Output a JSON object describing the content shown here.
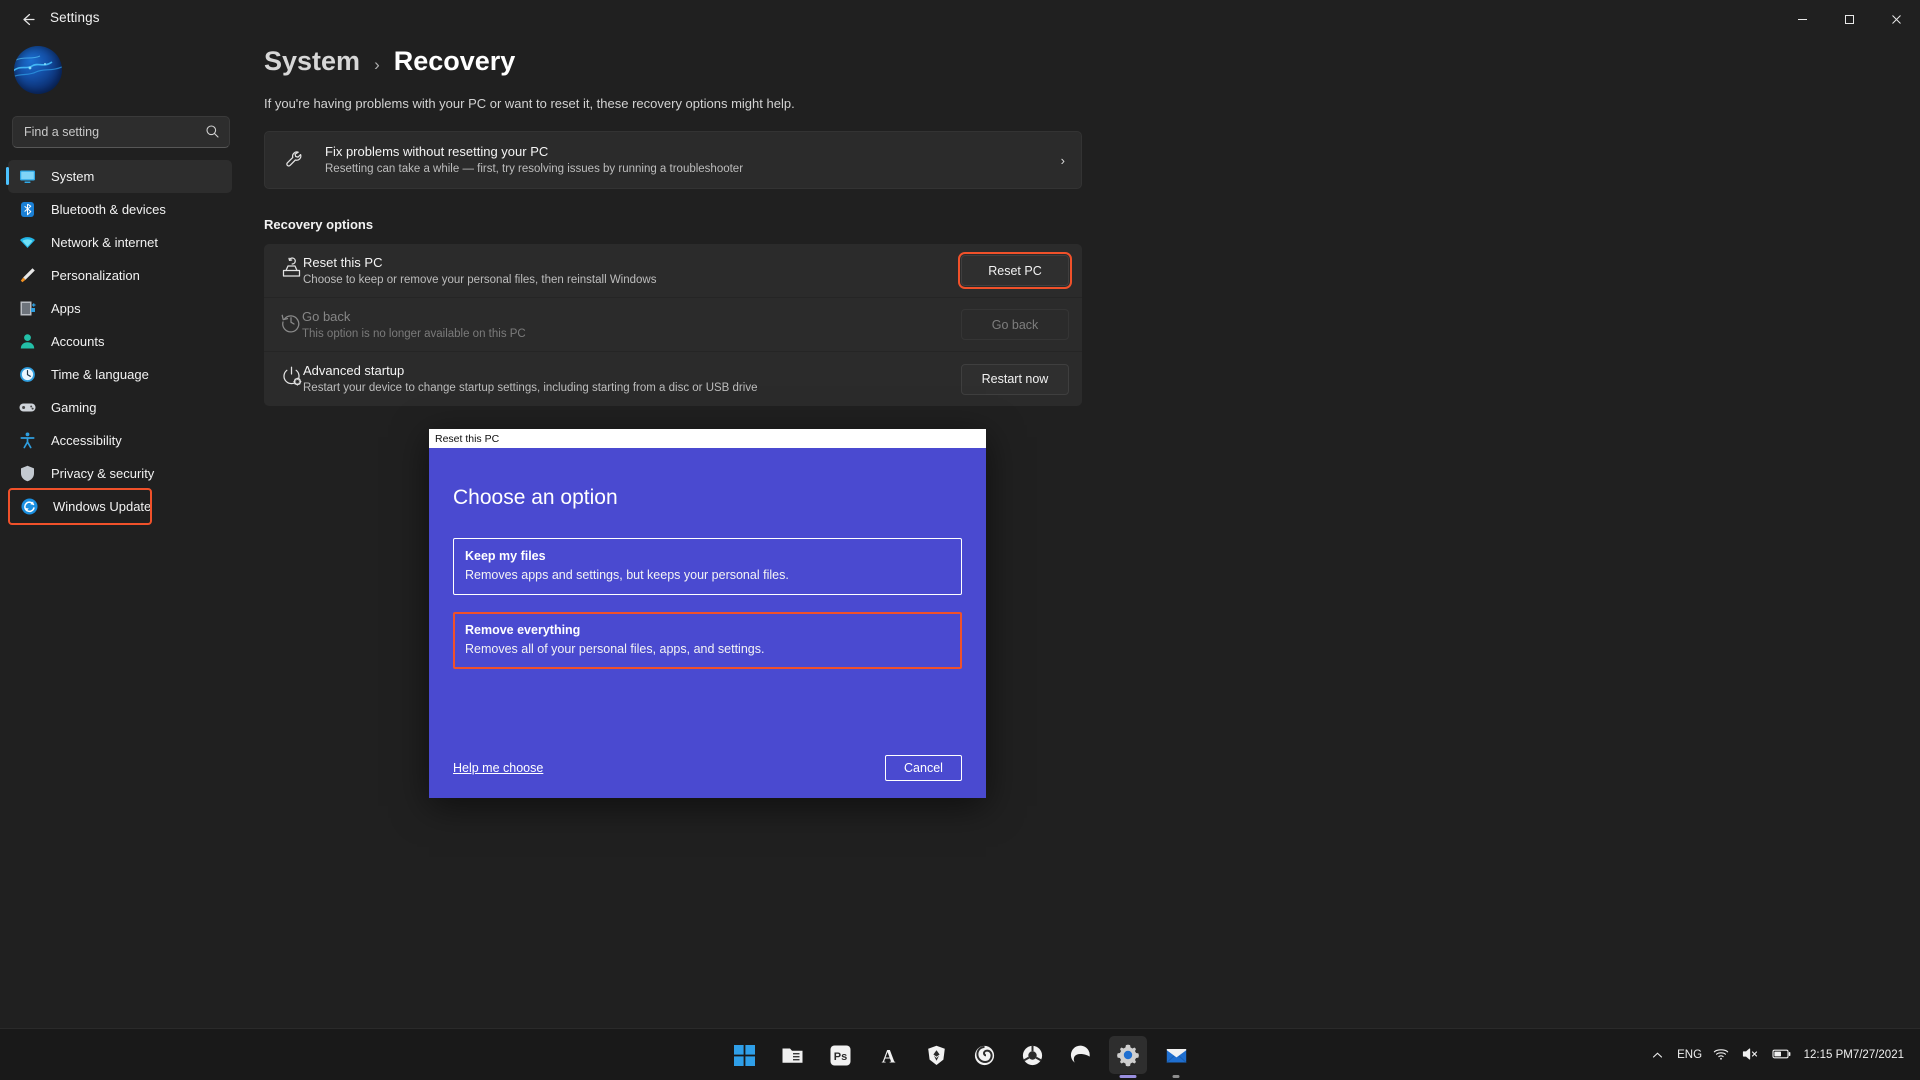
{
  "window": {
    "title": "Settings",
    "back_icon": "back-arrow-icon",
    "minimize": "–",
    "maximize": "❐",
    "close": "✕"
  },
  "sidebar": {
    "avatar_name": "user-avatar",
    "search": {
      "placeholder": "Find a setting",
      "icon": "search-icon"
    },
    "items": [
      {
        "label": "System",
        "icon": "system-monitor-icon",
        "state": "active"
      },
      {
        "label": "Bluetooth & devices",
        "icon": "bluetooth-icon",
        "state": "normal"
      },
      {
        "label": "Network & internet",
        "icon": "wifi-icon",
        "state": "normal"
      },
      {
        "label": "Personalization",
        "icon": "paintbrush-icon",
        "state": "normal"
      },
      {
        "label": "Apps",
        "icon": "apps-icon",
        "state": "normal"
      },
      {
        "label": "Accounts",
        "icon": "account-person-icon",
        "state": "normal"
      },
      {
        "label": "Time & language",
        "icon": "clock-icon",
        "state": "normal"
      },
      {
        "label": "Gaming",
        "icon": "gamepad-icon",
        "state": "normal"
      },
      {
        "label": "Accessibility",
        "icon": "accessibility-icon",
        "state": "normal"
      },
      {
        "label": "Privacy & security",
        "icon": "shield-icon",
        "state": "normal"
      },
      {
        "label": "Windows Update",
        "icon": "windows-update-icon",
        "state": "highlighted"
      }
    ]
  },
  "main": {
    "breadcrumb": {
      "parent": "System",
      "separator": "›",
      "current": "Recovery"
    },
    "subtitle": "If you're having problems with your PC or want to reset it, these recovery options might help.",
    "troubleshoot_card": {
      "icon": "wrench-icon",
      "title": "Fix problems without resetting your PC",
      "subtitle": "Resetting can take a while — first, try resolving issues by running a troubleshooter",
      "chevron": "›"
    },
    "section_header": "Recovery options",
    "rows": [
      {
        "icon": "reset-pc-icon",
        "title": "Reset this PC",
        "subtitle": "Choose to keep or remove your personal files, then reinstall Windows",
        "button": "Reset PC",
        "button_state": "highlighted"
      },
      {
        "icon": "history-clock-icon",
        "title": "Go back",
        "subtitle": "This option is no longer available on this PC",
        "button": "Go back",
        "button_state": "disabled"
      },
      {
        "icon": "power-settings-icon",
        "title": "Advanced startup",
        "subtitle": "Restart your device to change startup settings, including starting from a disc or USB drive",
        "button": "Restart now",
        "button_state": "normal"
      }
    ]
  },
  "dialog": {
    "titlebar": "Reset this PC",
    "heading": "Choose an option",
    "options": [
      {
        "title": "Keep my files",
        "desc": "Removes apps and settings, but keeps your personal files.",
        "state": "normal"
      },
      {
        "title": "Remove everything",
        "desc": "Removes all of your personal files, apps, and settings.",
        "state": "highlighted"
      }
    ],
    "help_link": "Help me choose",
    "cancel_button": "Cancel"
  },
  "taskbar": {
    "apps": [
      {
        "name": "start-icon",
        "active": false,
        "light": false
      },
      {
        "name": "file-explorer-icon",
        "active": false,
        "light": false
      },
      {
        "name": "photoshop-icon",
        "active": false,
        "light": false
      },
      {
        "name": "adobe-acrobat-icon",
        "active": false,
        "light": false
      },
      {
        "name": "brave-browser-icon",
        "active": false,
        "light": false
      },
      {
        "name": "firefox-icon",
        "active": false,
        "light": false
      },
      {
        "name": "chrome-icon",
        "active": false,
        "light": false
      },
      {
        "name": "edge-icon",
        "active": false,
        "light": false
      },
      {
        "name": "settings-icon",
        "active": true,
        "light": false
      },
      {
        "name": "mail-icon",
        "active": false,
        "light": true
      }
    ],
    "tray": {
      "chevron": "∧",
      "language": "ENG",
      "wifi_icon": "wifi-icon",
      "volume_icon": "volume-muted-icon",
      "battery_icon": "battery-icon",
      "time": "12:15 PM",
      "date": "7/27/2021"
    }
  },
  "colors": {
    "accent": "#4cc2ff",
    "highlight": "#f0512a",
    "dialog_bg": "#4a4ad0",
    "app_bg": "#202020",
    "card_bg": "#2b2b2b"
  }
}
